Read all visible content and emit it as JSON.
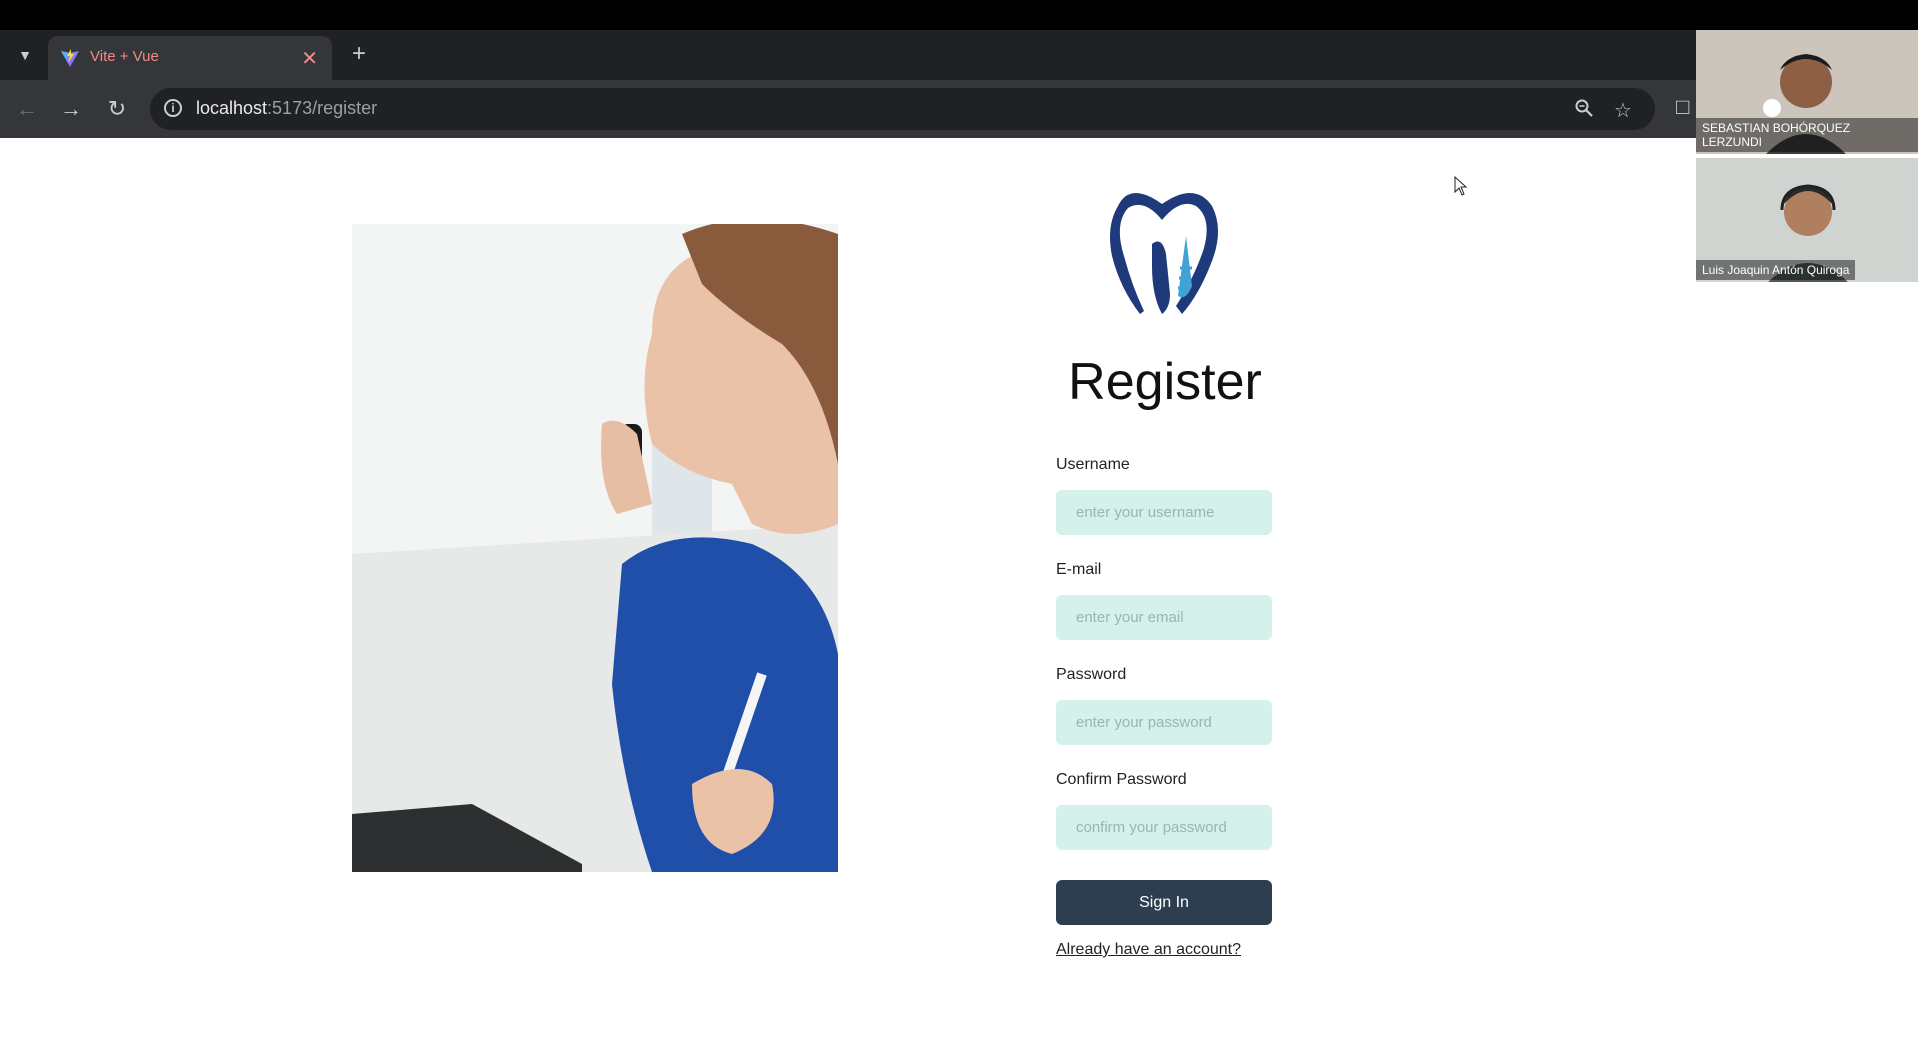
{
  "browser": {
    "tab": {
      "title": "Vite + Vue",
      "favicon": "vite-logo"
    },
    "address": {
      "host": "localhost",
      "path": ":5173/register"
    }
  },
  "page": {
    "heading": "Register",
    "form": {
      "username": {
        "label": "Username",
        "placeholder": "enter your username"
      },
      "email": {
        "label": "E-mail",
        "placeholder": "enter your email"
      },
      "password": {
        "label": "Password",
        "placeholder": "enter your password"
      },
      "confirm": {
        "label": "Confirm Password",
        "placeholder": "confirm your password"
      },
      "submit_label": "Sign In",
      "login_link": "Already have an account?"
    },
    "colors": {
      "input_bg": "#d4f1ec",
      "button_bg": "#2c3e50",
      "logo_dark": "#1f3a7a",
      "logo_light": "#3fa3d6"
    }
  },
  "video_call": {
    "participants": [
      {
        "name": "SEBASTIAN BOHÓRQUEZ LERZUNDI"
      },
      {
        "name": "Luis Joaquin Antón Quiroga"
      }
    ]
  }
}
